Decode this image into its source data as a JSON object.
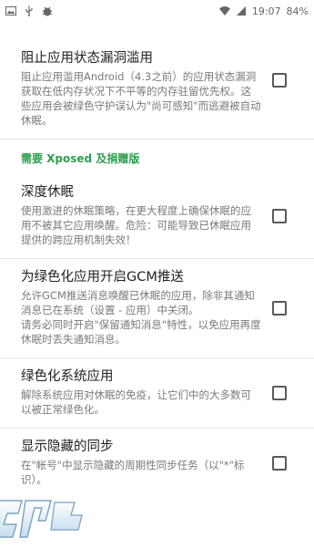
{
  "status_bar": {
    "time": "19:07",
    "battery": "84%",
    "left_icons": [
      "image-icon",
      "usb-icon",
      "android-debug-icon"
    ],
    "right_icons": [
      "wifi-icon",
      "signal-icon",
      "battery-icon"
    ]
  },
  "settings": [
    {
      "title": "阻止应用状态漏洞滥用",
      "description": "阻止应用滥用Android（4.3之前）的应用状态漏洞获取在低内存状况下不平等的内存驻留优先权。这些应用会被绿色守护误认为\"尚可感知\"而逃避被自动休眠。",
      "checked": false
    }
  ],
  "section": {
    "label": "需要 Xposed 及捐赠版"
  },
  "xposed_settings": [
    {
      "title": "深度休眠",
      "description": "使用激进的休眠策略，在更大程度上确保休眠的应用不被其它应用唤醒。危险：可能导致已休眠应用提供的跨应用机制失效！",
      "checked": false
    },
    {
      "title": "为绿色化应用开启GCM推送",
      "description": "允许GCM推送消息唤醒已休眠的应用，除非其通知消息已在系统（设置 - 应用）中关闭。",
      "description2": "请务必同时开启\"保留通知消息\"特性，以免应用再度休眠时丢失通知消息。",
      "checked": false
    },
    {
      "title": "绿色化系统应用",
      "description": "解除系统应用对休眠的免疫，让它们中的大多数可以被正常绿色化。",
      "checked": false
    },
    {
      "title": "显示隐藏的同步",
      "description": "在\"帐号\"中显示隐藏的周期性同步任务（以\"*\"标识）。",
      "checked": false
    }
  ],
  "colors": {
    "section_accent": "#2e9e4f",
    "title": "#212121",
    "description": "#7a7a7a"
  }
}
